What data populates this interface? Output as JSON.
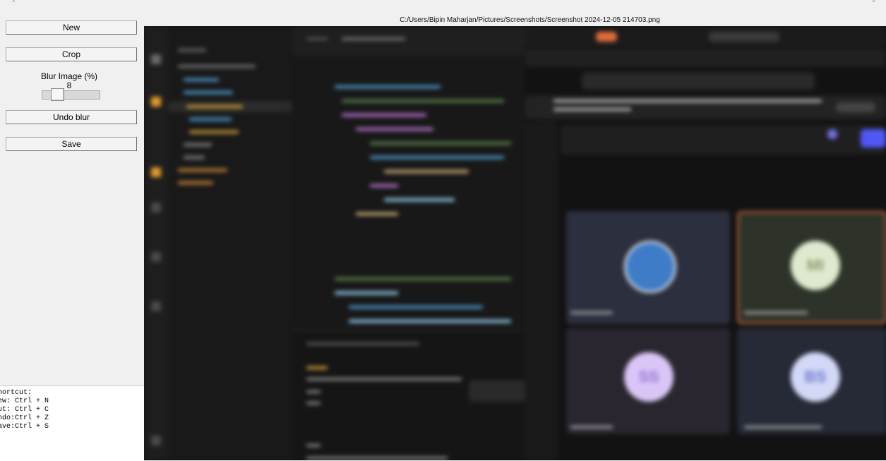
{
  "controls": {
    "new_label": "New",
    "crop_label": "Crop",
    "blur_label": "Blur Image (%)",
    "blur_value": "8",
    "blur_percent": 8,
    "undo_blur_label": "Undo blur",
    "save_label": "Save"
  },
  "shortcuts": {
    "lines": [
      "hortcut:",
      "ew: Ctrl + N",
      "ut: Ctrl + C",
      "ndo:Ctrl + Z",
      "ave:Ctrl + S"
    ]
  },
  "viewer": {
    "path": "C:/Users/Bipin Maharjan/Pictures/Screenshots/Screenshot 2024-12-05 214703.png"
  },
  "screenshot_content": {
    "avatars": [
      {
        "initials": "MI",
        "color": "#dfe9cf",
        "text_color": "#8a9b6a"
      },
      {
        "initials": "SS",
        "color": "#d9c6f6",
        "text_color": "#9172cf"
      },
      {
        "initials": "BS",
        "color": "#d2d8f6",
        "text_color": "#6b77cf"
      }
    ]
  },
  "colors": {
    "panel_bg": "#f0f0f0",
    "teams_accent": "#4f58f5",
    "highlight_border": "#b25a3c"
  }
}
